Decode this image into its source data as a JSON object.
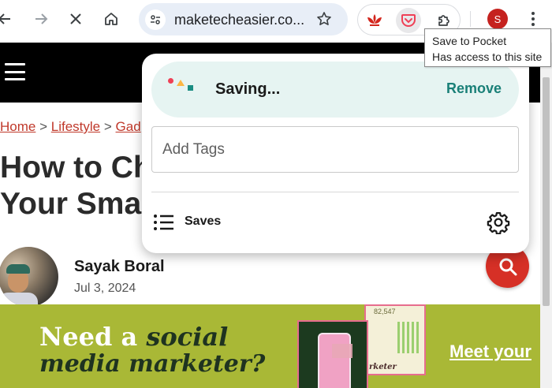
{
  "toolbar": {
    "url": "maketecheasier.co...",
    "icons": [
      "back-arrow-icon",
      "forward-arrow-icon",
      "stop-loading-icon",
      "home-icon",
      "site-info-icon",
      "bookmark-star-icon",
      "extension-icon",
      "more-menu-icon"
    ],
    "profile_initial": "S"
  },
  "tooltip": {
    "title": "Save to Pocket",
    "subtitle": "Has access to this site"
  },
  "page": {
    "breadcrumb": {
      "home": "Home",
      "sep1": ">",
      "section": "Lifestyle",
      "sep2": ">",
      "sub": "Gad"
    },
    "title_line1": "How to Ch",
    "title_line2": "Your Smar",
    "author": {
      "name": "Sayak Boral",
      "date": "Jul 3, 2024"
    }
  },
  "ad": {
    "line1_plain": "Need a",
    "line1_italic": "social",
    "line2": "media marketer?",
    "card_number": "82,547",
    "card_word": "rketer",
    "cta": "Meet your"
  },
  "pocket": {
    "status": "Saving...",
    "remove_label": "Remove",
    "tags_placeholder": "Add Tags",
    "saves_label": "Saves"
  },
  "colors": {
    "pocket_accent": "#1a8078",
    "pocket_status_bg": "#e6f4f2",
    "search_fab": "#d63026",
    "ad_bg": "#a9b836",
    "link": "#c0392b"
  }
}
